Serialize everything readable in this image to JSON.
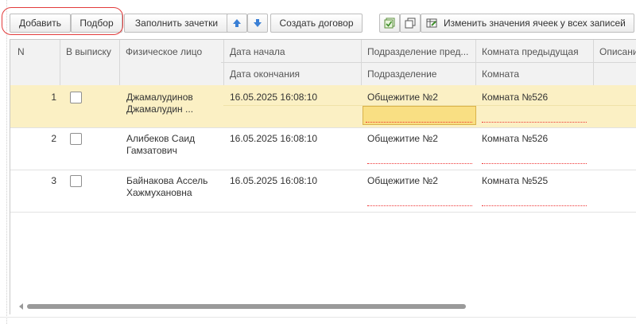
{
  "toolbar": {
    "add_label": "Добавить",
    "pick_label": "Подбор",
    "fill_label": "Заполнить зачетки",
    "create_contract_label": "Создать договор",
    "change_cells_label": "Изменить значения ячеек у всех записей"
  },
  "table": {
    "headers": {
      "n": "N",
      "to_extract": "В выписку",
      "person": "Физическое лицо",
      "date_start": "Дата начала",
      "date_end": "Дата окончания",
      "prev_division": "Подразделение пред...",
      "division": "Подразделение",
      "prev_room": "Комната предыдущая",
      "room": "Комната",
      "description": "Описани"
    },
    "rows": [
      {
        "n": "1",
        "person_line1": "Джамалудинов",
        "person_line2": "Джамалудин ...",
        "date_start": "16.05.2025 16:08:10",
        "prev_division": "Общежитие №2",
        "prev_room": "Комната №526"
      },
      {
        "n": "2",
        "person_line1": "Алибеков Саид",
        "person_line2": "Гамзатович",
        "date_start": "16.05.2025 16:08:10",
        "prev_division": "Общежитие №2",
        "prev_room": "Комната №526"
      },
      {
        "n": "3",
        "person_line1": "Байнакова Ассель",
        "person_line2": "Хажмухановна",
        "date_start": "16.05.2025 16:08:10",
        "prev_division": "Общежитие №2",
        "prev_room": "Комната №525"
      }
    ]
  },
  "colors": {
    "selected_row": "#fbf0c4",
    "focused_cell": "#f9df83",
    "highlight_oval": "#e23b3b",
    "arrow_blue": "#3a7fd5"
  }
}
